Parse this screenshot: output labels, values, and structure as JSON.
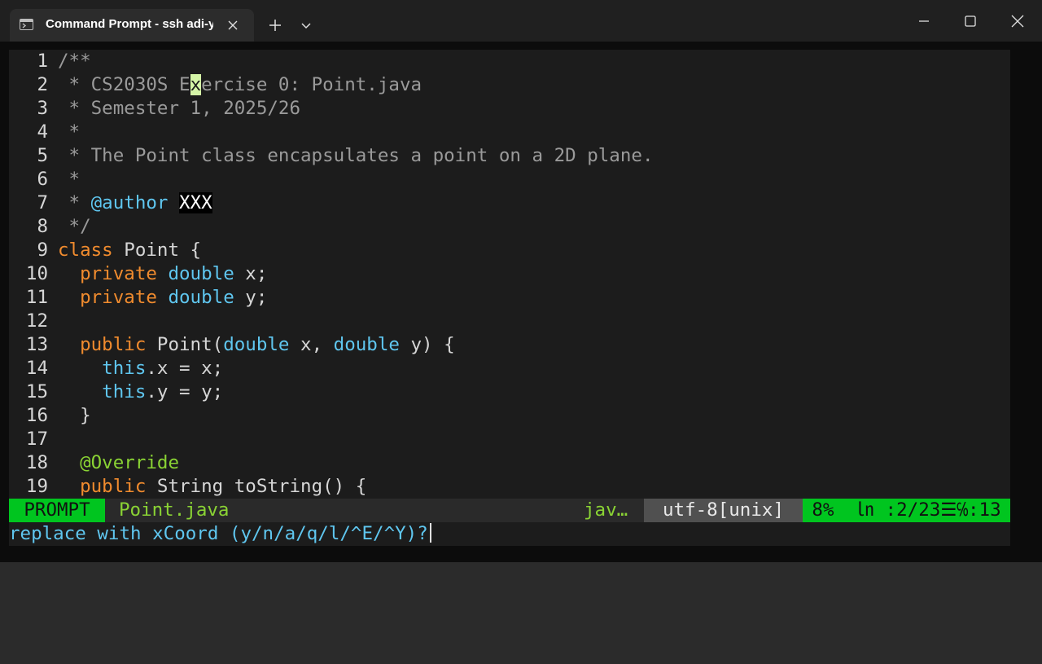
{
  "window": {
    "tab_title": "Command Prompt - ssh  adi-y",
    "icons": {
      "tab": "terminal-icon",
      "close": "close-icon",
      "new_tab": "plus-icon",
      "dropdown": "chevron-down-icon",
      "minimize": "minimize-icon",
      "maximize": "maximize-icon",
      "window_close": "window-close-icon"
    }
  },
  "editor": {
    "cursor_line": 2,
    "cursor_col": 13,
    "lines": [
      {
        "n": "1",
        "segments": [
          {
            "t": "/**",
            "c": "com"
          }
        ]
      },
      {
        "n": "2",
        "segments": [
          {
            "t": " * CS2030S E",
            "c": "com"
          },
          {
            "t": "x",
            "c": "cursor"
          },
          {
            "t": "ercise 0: Point.java",
            "c": "com"
          }
        ]
      },
      {
        "n": "3",
        "segments": [
          {
            "t": " * Semester 1, 2025/26",
            "c": "com"
          }
        ]
      },
      {
        "n": "4",
        "segments": [
          {
            "t": " *",
            "c": "com"
          }
        ]
      },
      {
        "n": "5",
        "segments": [
          {
            "t": " * The Point class encapsulates a point on a 2D plane.",
            "c": "com"
          }
        ]
      },
      {
        "n": "6",
        "segments": [
          {
            "t": " *",
            "c": "com"
          }
        ]
      },
      {
        "n": "7",
        "segments": [
          {
            "t": " * ",
            "c": "com"
          },
          {
            "t": "@author",
            "c": "tag"
          },
          {
            "t": " ",
            "c": ""
          },
          {
            "t": "XXX",
            "c": "hl"
          }
        ]
      },
      {
        "n": "8",
        "segments": [
          {
            "t": " */",
            "c": "com"
          }
        ]
      },
      {
        "n": "9",
        "segments": [
          {
            "t": "class",
            "c": "kw"
          },
          {
            "t": " Point {",
            "c": ""
          }
        ]
      },
      {
        "n": "10",
        "segments": [
          {
            "t": "  ",
            "c": ""
          },
          {
            "t": "private",
            "c": "kw"
          },
          {
            "t": " ",
            "c": ""
          },
          {
            "t": "double",
            "c": "type"
          },
          {
            "t": " x;",
            "c": ""
          }
        ]
      },
      {
        "n": "11",
        "segments": [
          {
            "t": "  ",
            "c": ""
          },
          {
            "t": "private",
            "c": "kw"
          },
          {
            "t": " ",
            "c": ""
          },
          {
            "t": "double",
            "c": "type"
          },
          {
            "t": " y;",
            "c": ""
          }
        ]
      },
      {
        "n": "12",
        "segments": []
      },
      {
        "n": "13",
        "segments": [
          {
            "t": "  ",
            "c": ""
          },
          {
            "t": "public",
            "c": "kw"
          },
          {
            "t": " Point(",
            "c": ""
          },
          {
            "t": "double",
            "c": "type"
          },
          {
            "t": " x, ",
            "c": ""
          },
          {
            "t": "double",
            "c": "type"
          },
          {
            "t": " y) {",
            "c": ""
          }
        ]
      },
      {
        "n": "14",
        "segments": [
          {
            "t": "    ",
            "c": ""
          },
          {
            "t": "this",
            "c": "type"
          },
          {
            "t": ".x = x;",
            "c": ""
          }
        ]
      },
      {
        "n": "15",
        "segments": [
          {
            "t": "    ",
            "c": ""
          },
          {
            "t": "this",
            "c": "type"
          },
          {
            "t": ".y = y;",
            "c": ""
          }
        ]
      },
      {
        "n": "16",
        "segments": [
          {
            "t": "  }",
            "c": ""
          }
        ]
      },
      {
        "n": "17",
        "segments": []
      },
      {
        "n": "18",
        "segments": [
          {
            "t": "  ",
            "c": ""
          },
          {
            "t": "@Override",
            "c": "ann"
          }
        ]
      },
      {
        "n": "19",
        "segments": [
          {
            "t": "  ",
            "c": ""
          },
          {
            "t": "public",
            "c": "kw"
          },
          {
            "t": " String toString() {",
            "c": ""
          }
        ]
      }
    ]
  },
  "statusline": {
    "mode": "PROMPT",
    "filename": "Point.java",
    "filetype": "jav…",
    "encoding": "utf-8[unix]",
    "position": "8%  ㏑ :2/23☰℅:13"
  },
  "cmdline": {
    "prompt": "replace with xCoord (y/n/a/q/l/^E/^Y)?"
  },
  "colors": {
    "comment": "#9a9a9a",
    "keyword": "#f08b2e",
    "type": "#5fc6ef",
    "annotation": "#8ad334",
    "status_mode_bg": "#00c51f",
    "cursor_bg": "#d5f5a7"
  }
}
